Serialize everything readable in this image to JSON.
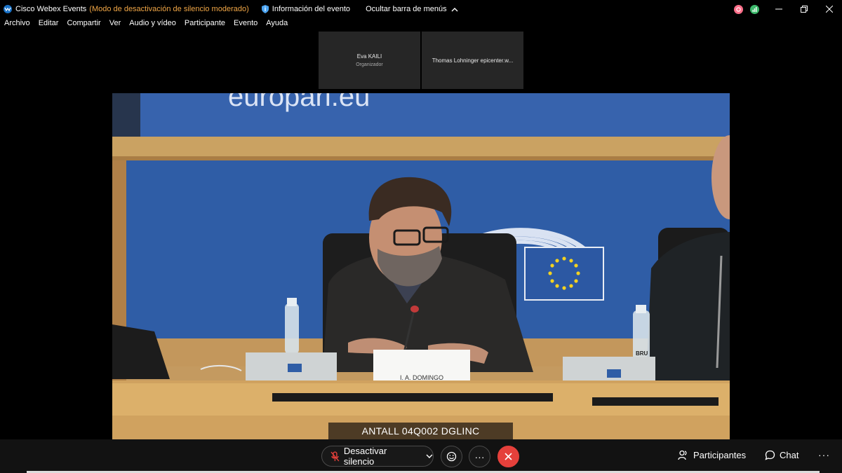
{
  "window": {
    "app_name": "Cisco Webex Events",
    "mode": "(Modo de desactivación de silencio moderado)",
    "event_info": "Información del evento",
    "hide_menu_bar": "Ocultar barra de menús",
    "icons": [
      "webex-logo-icon",
      "shield-info-icon",
      "chevron-up-icon",
      "recording-status-icon",
      "network-status-icon",
      "minimize-icon",
      "restore-icon",
      "close-icon"
    ]
  },
  "menu": {
    "items": [
      "Archivo",
      "Editar",
      "Compartir",
      "Ver",
      "Audio y vídeo",
      "Participante",
      "Evento",
      "Ayuda"
    ]
  },
  "thumbnails": [
    {
      "name": "Eva KAILI",
      "role": "Organizador"
    },
    {
      "name": "Thomas Lohninger epicenter.w..."
    }
  ],
  "video": {
    "nameplate": "I. A. DOMINGO",
    "banner_text": "europarl.eu",
    "caption": "ANTALL 04Q002 DGLINC",
    "bottle_label": "BRU"
  },
  "toolbar": {
    "unmute_label": "Desactivar silencio",
    "participants_label": "Participantes",
    "chat_label": "Chat",
    "more": "···",
    "overflow": "···"
  },
  "colors": {
    "accent_orange": "#f0a646",
    "leave_red": "#e5403b",
    "eu_blue": "#2f5da6"
  }
}
